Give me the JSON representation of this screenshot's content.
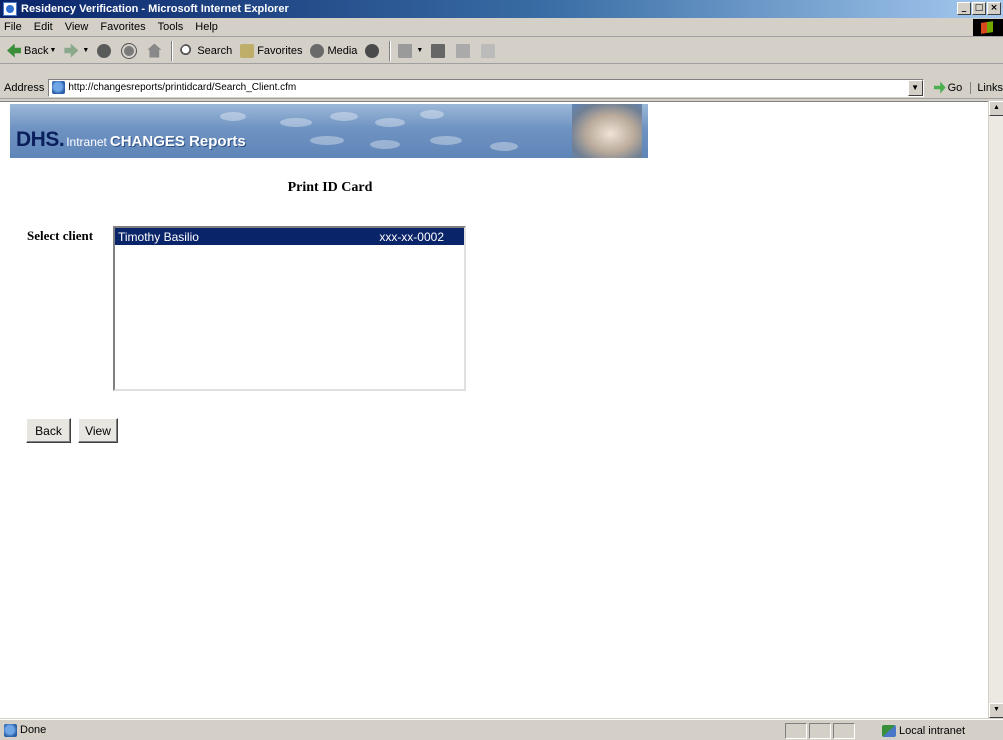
{
  "window": {
    "title": "Residency Verification - Microsoft Internet Explorer"
  },
  "menu": [
    "File",
    "Edit",
    "View",
    "Favorites",
    "Tools",
    "Help"
  ],
  "toolbar": {
    "back_label": "Back",
    "search_label": "Search",
    "favorites_label": "Favorites",
    "media_label": "Media"
  },
  "address": {
    "label": "Address",
    "url": "http://changesreports/printidcard/Search_Client.cfm",
    "go_label": "Go",
    "links_label": "Links"
  },
  "banner": {
    "brand": "DHS.",
    "intranet": "Intranet",
    "app_name": "CHANGES Reports"
  },
  "page": {
    "title": "Print ID Card",
    "select_label": "Select client",
    "clients": [
      {
        "name": "Timothy Basilio",
        "ssn": "xxx-xx-0002",
        "selected": true
      }
    ],
    "back_button": "Back",
    "view_button": "View"
  },
  "status": {
    "text": "Done",
    "zone": "Local intranet"
  }
}
